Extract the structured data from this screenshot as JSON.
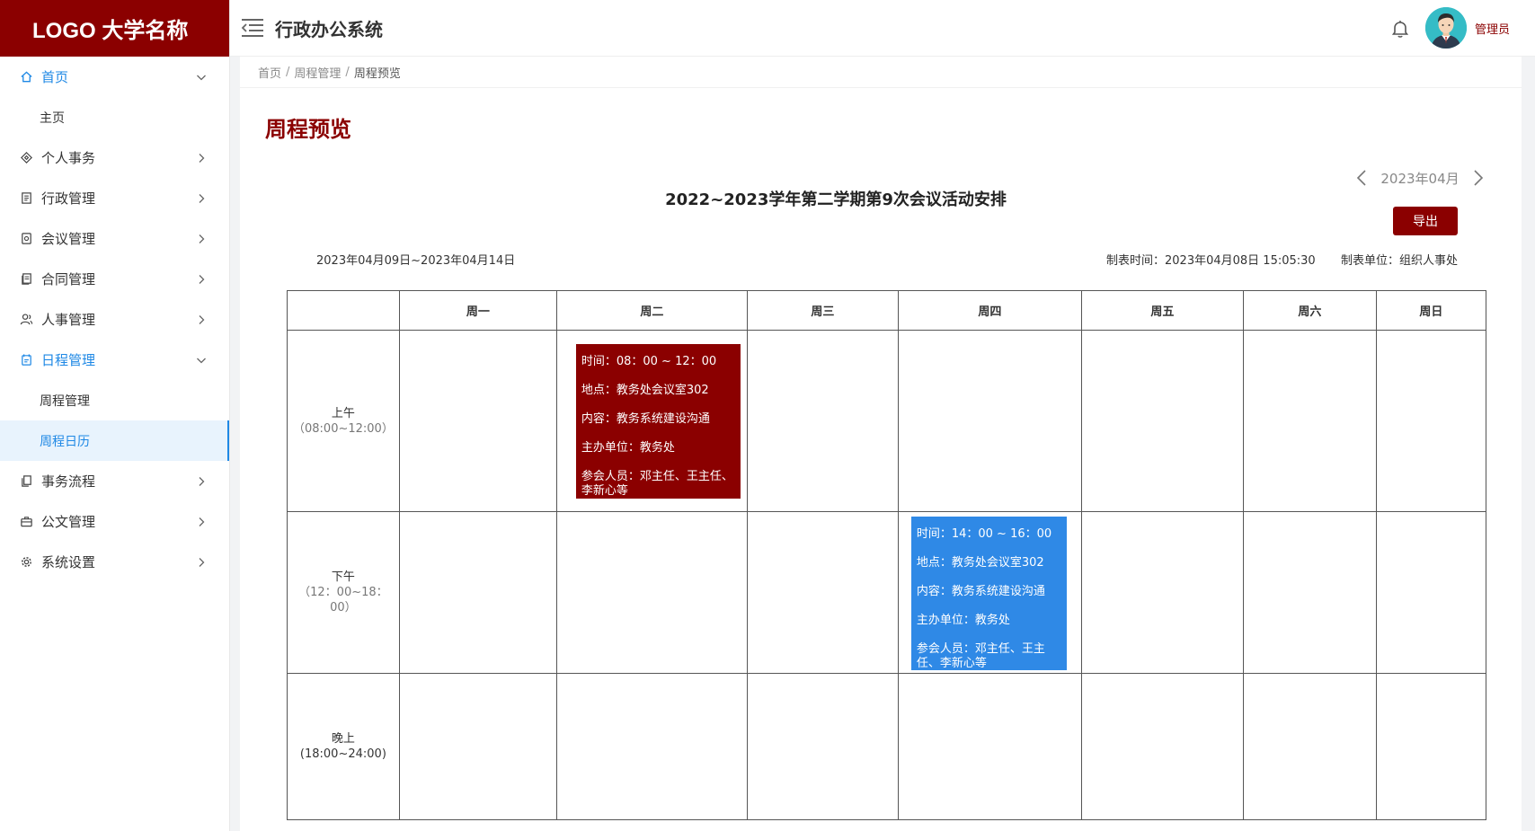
{
  "app": {
    "logo": "LOGO 大学名称",
    "system_title": "行政办公系统",
    "username": "管理员"
  },
  "sidebar": {
    "items": [
      {
        "label": "首页",
        "icon": "home-icon",
        "expanded": true
      },
      {
        "label": "主页",
        "sub": true
      },
      {
        "label": "个人事务",
        "icon": "diamond-icon"
      },
      {
        "label": "行政管理",
        "icon": "document-icon"
      },
      {
        "label": "会议管理",
        "icon": "meeting-icon"
      },
      {
        "label": "合同管理",
        "icon": "contract-icon"
      },
      {
        "label": "人事管理",
        "icon": "people-icon"
      },
      {
        "label": "日程管理",
        "icon": "calendar-icon",
        "expanded": true,
        "active": true
      },
      {
        "label": "周程管理",
        "sub": true
      },
      {
        "label": "周程日历",
        "sub": true,
        "selected": true
      },
      {
        "label": "事务流程",
        "icon": "copy-icon"
      },
      {
        "label": "公文管理",
        "icon": "briefcase-icon"
      },
      {
        "label": "系统设置",
        "icon": "gear-icon"
      }
    ]
  },
  "breadcrumb": [
    "首页",
    "周程管理",
    "周程预览"
  ],
  "page": {
    "title": "周程预览",
    "month": "2023年04月",
    "export_label": "导出",
    "schedule_title": "2022~2023学年第二学期第9次会议活动安排",
    "date_range": "2023年04月09日~2023年04月14日",
    "made_time": "制表时间：2023年04月08日 15:05:30",
    "made_unit": "制表单位：组织人事处"
  },
  "table": {
    "days": [
      "周一",
      "周二",
      "周三",
      "周四",
      "周五",
      "周六",
      "周日"
    ],
    "periods": [
      {
        "name": "上午",
        "range": "（08:00~12:00）"
      },
      {
        "name": "下午",
        "range": "（12：00~18：00）"
      },
      {
        "name": "晚上",
        "range": "(18:00~24:00)"
      }
    ],
    "events": [
      {
        "period": 0,
        "day": 1,
        "color": "#8b0000",
        "time": "时间：08：00 ~ 12：00",
        "place": "地点：教务处会议室302",
        "content": "内容：教务系统建设沟通",
        "host": "主办单位：教务处",
        "attendees": "参会人员：邓主任、王主任、李新心等"
      },
      {
        "period": 1,
        "day": 3,
        "color": "#2f89e6",
        "time": "时间：14：00 ~ 16：00",
        "place": "地点：教务处会议室302",
        "content": "内容：教务系统建设沟通",
        "host": "主办单位：教务处",
        "attendees": "参会人员：邓主任、王主任、李新心等"
      }
    ]
  },
  "colors": {
    "brand": "#8b0000",
    "accent": "#1e88e5",
    "event_red": "#8b0000",
    "event_blue": "#2f89e6"
  }
}
